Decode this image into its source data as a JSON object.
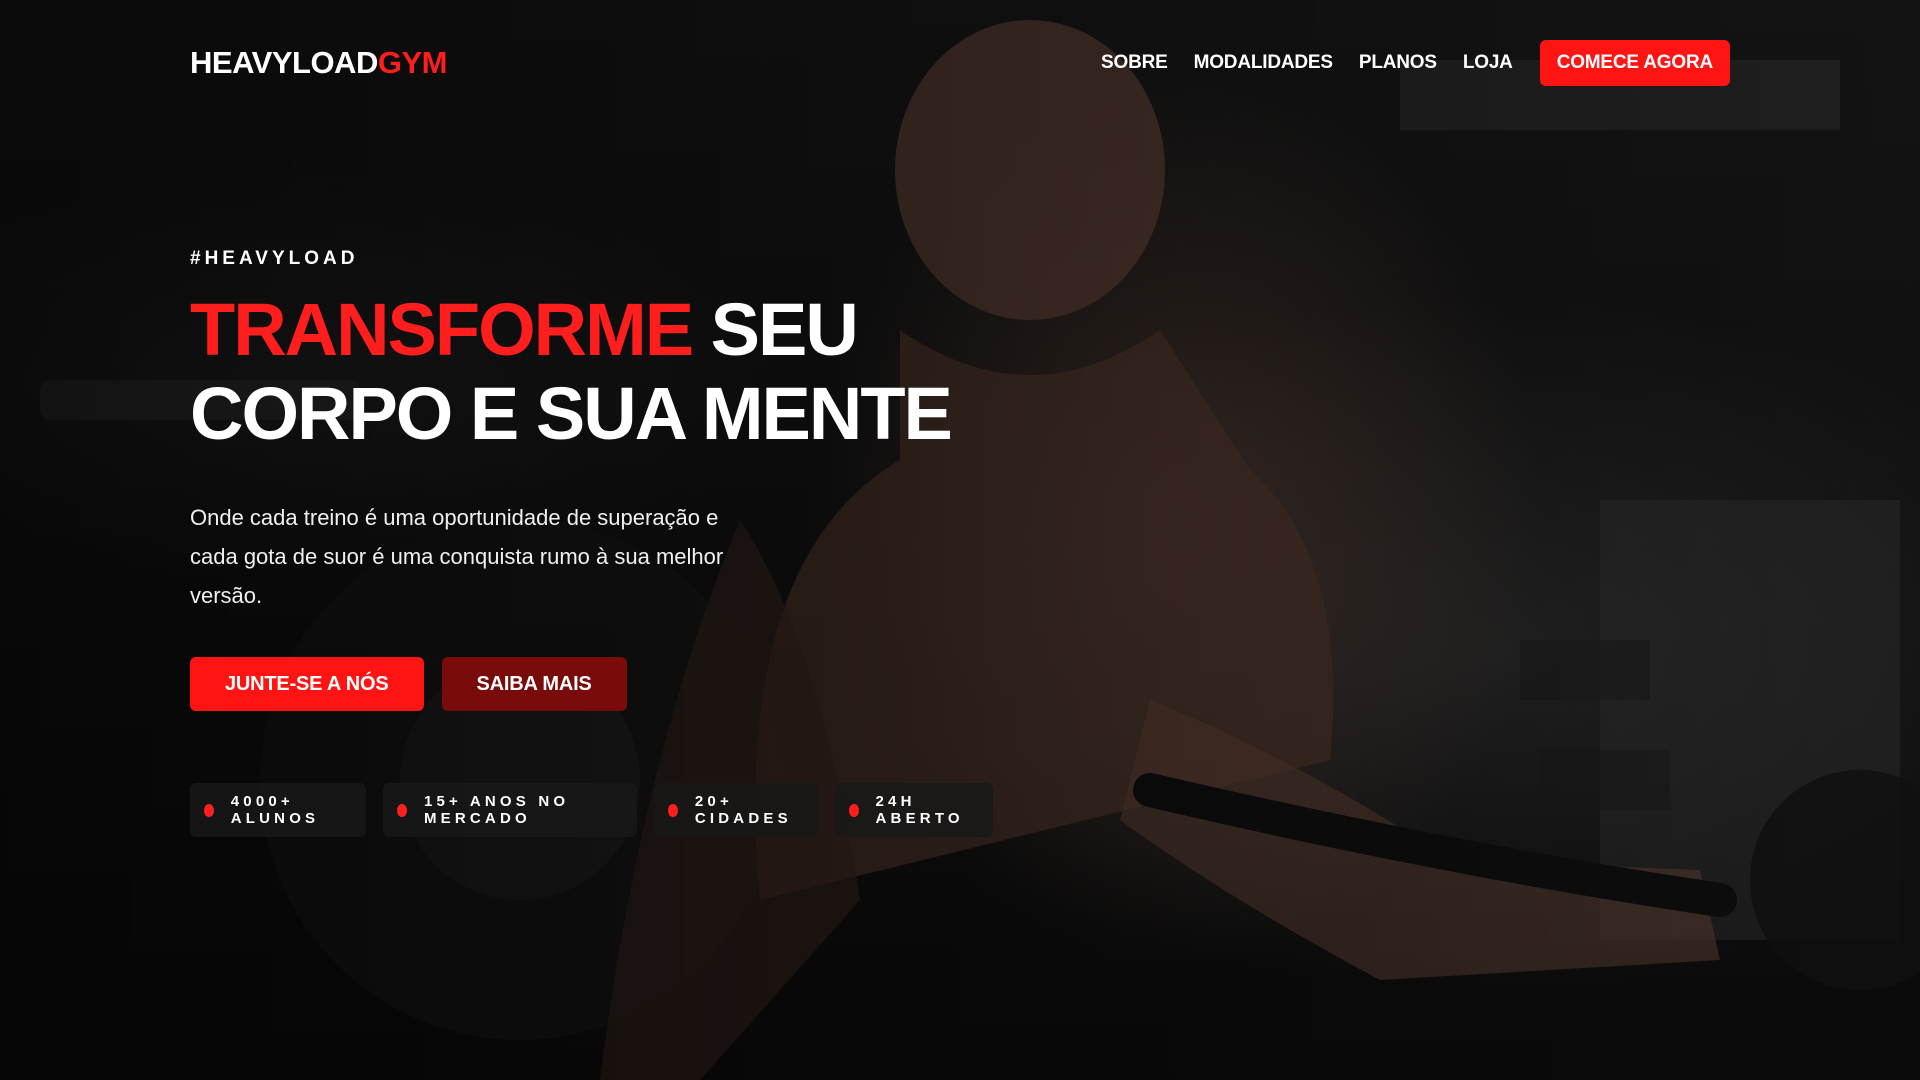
{
  "brand": {
    "name_main": "HEAVYLOAD",
    "name_accent": "GYM",
    "accent_color": "#ff1e1e"
  },
  "nav": {
    "items": [
      {
        "label": "SOBRE"
      },
      {
        "label": "MODALIDADES"
      },
      {
        "label": "PLANOS"
      },
      {
        "label": "LOJA"
      }
    ],
    "cta_label": "COMECE AGORA"
  },
  "hero": {
    "tag": "#HEAVYLOAD",
    "headline_accent": "TRANSFORME",
    "headline_rest_line1": "SEU",
    "headline_line2": "CORPO E SUA MENTE",
    "description": "Onde cada treino é uma oportunidade de superação e cada gota de suor é uma conquista rumo à sua melhor versão.",
    "primary_button": "JUNTE-SE A NÓS",
    "secondary_button": "SAIBA MAIS",
    "background_image": "man-lifting-weights-in-gym"
  },
  "stats": [
    {
      "label": "4000+ ALUNOS"
    },
    {
      "label": "15+ ANOS NO MERCADO"
    },
    {
      "label": "20+ CIDADES"
    },
    {
      "label": "24H ABERTO"
    }
  ],
  "colors": {
    "primary_red": "#ff1414",
    "dark_red": "#7a0b0b",
    "stat_bg": "#181818"
  }
}
